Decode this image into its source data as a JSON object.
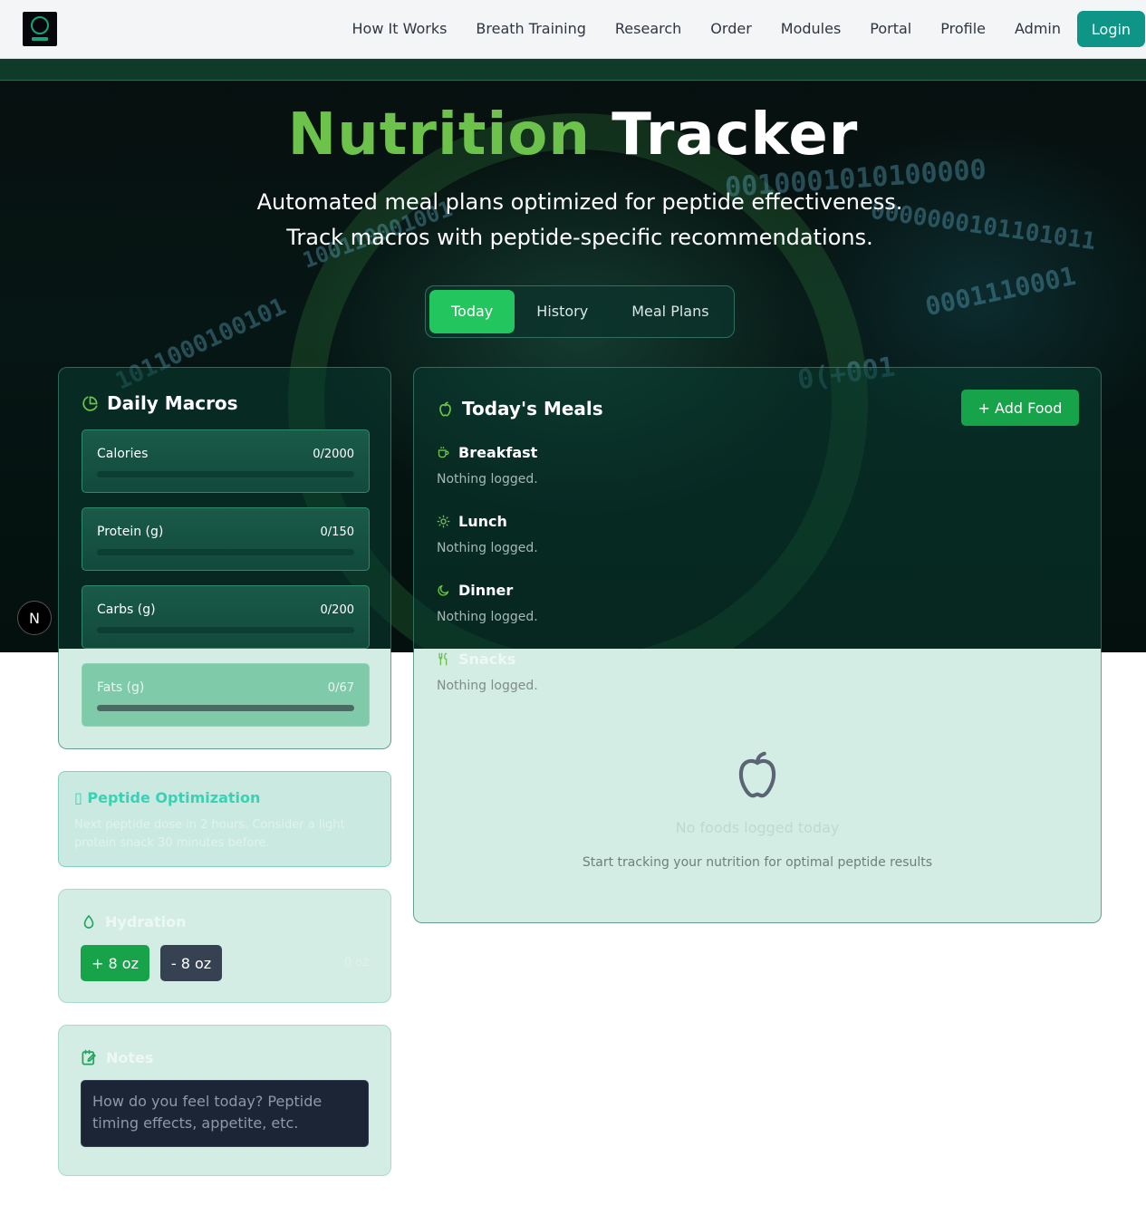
{
  "header": {
    "nav": [
      "How It Works",
      "Breath Training",
      "Research",
      "Order",
      "Modules",
      "Portal",
      "Profile",
      "Admin"
    ],
    "login_label": "Login"
  },
  "hero": {
    "title_accent": "Nutrition",
    "title_main": "Tracker",
    "subtitle_line1": "Automated meal plans optimized for peptide effectiveness.",
    "subtitle_line2": "Track macros with peptide-specific recommendations.",
    "background_binary": [
      "0010001010100000",
      "0000000101101011",
      "1011000100101",
      "100110001001",
      "0001110001",
      "0(+001"
    ],
    "nav_badge": "N"
  },
  "tabs": [
    {
      "label": "Today",
      "active": true
    },
    {
      "label": "History",
      "active": false
    },
    {
      "label": "Meal Plans",
      "active": false
    }
  ],
  "macros": {
    "title": "Daily Macros",
    "items": [
      {
        "label": "Calories",
        "value": "0/2000",
        "progress": 0
      },
      {
        "label": "Protein (g)",
        "value": "0/150",
        "progress": 0
      },
      {
        "label": "Carbs (g)",
        "value": "0/200",
        "progress": 0
      },
      {
        "label": "Fats (g)",
        "value": "0/67",
        "progress": 0
      }
    ]
  },
  "peptide": {
    "title": "Peptide Optimization",
    "text": "Next peptide dose in 2 hours. Consider a light protein snack 30 minutes before."
  },
  "hydration": {
    "title": "Hydration",
    "plus_label": "+ 8 oz",
    "minus_label": "- 8 oz",
    "value": "0 oz"
  },
  "notes": {
    "title": "Notes",
    "placeholder": "How do you feel today? Peptide timing effects, appetite, etc."
  },
  "meals": {
    "title": "Today's Meals",
    "add_label": "+ Add Food",
    "sections": [
      {
        "name": "Breakfast",
        "icon": "coffee-icon",
        "empty": "Nothing logged."
      },
      {
        "name": "Lunch",
        "icon": "sun-icon",
        "empty": "Nothing logged."
      },
      {
        "name": "Dinner",
        "icon": "moon-icon",
        "empty": "Nothing logged."
      },
      {
        "name": "Snacks",
        "icon": "utensils-icon",
        "empty": "Nothing logged."
      }
    ],
    "empty_title": "No foods logged today",
    "empty_subtitle": "Start tracking your nutrition for optimal peptide results"
  },
  "colors": {
    "accent_green": "#22c55e",
    "title_green": "#6cc24a",
    "login_teal": "#0f9488",
    "peptide_teal": "#3bd1b4"
  }
}
